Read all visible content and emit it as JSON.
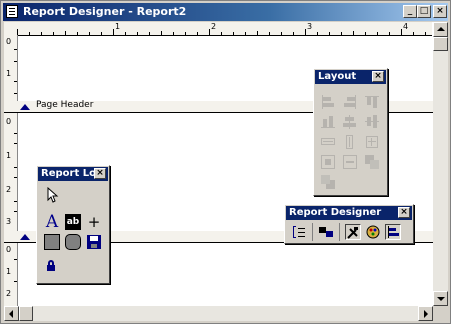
{
  "window": {
    "title": "Report Designer - Report2",
    "minimize_glyph": "_",
    "maximize_glyph": "□",
    "close_glyph": "×"
  },
  "ruler": {
    "h_numbers": [
      "1",
      "2",
      "3",
      "4"
    ],
    "v_numbers_top": [
      "0",
      "1"
    ],
    "v_numbers_mid": [
      "0",
      "1",
      "2",
      "3"
    ],
    "v_numbers_bottom": [
      "0",
      "1",
      "2"
    ]
  },
  "sections": {
    "page_header_label": "Page Header"
  },
  "palettes": {
    "layout": {
      "title": "Layout",
      "close_glyph": "×"
    },
    "report_lo": {
      "title": "Report Lo",
      "close_glyph": "×"
    },
    "report_designer": {
      "title": "Report Designer",
      "close_glyph": "×"
    }
  },
  "toolbox": {
    "text_tool_glyph": "A",
    "field_tool_glyph": "ab",
    "line_tool_glyph": "+"
  },
  "colors": {
    "titlebar": "#0a246a",
    "accent": "#000080"
  }
}
